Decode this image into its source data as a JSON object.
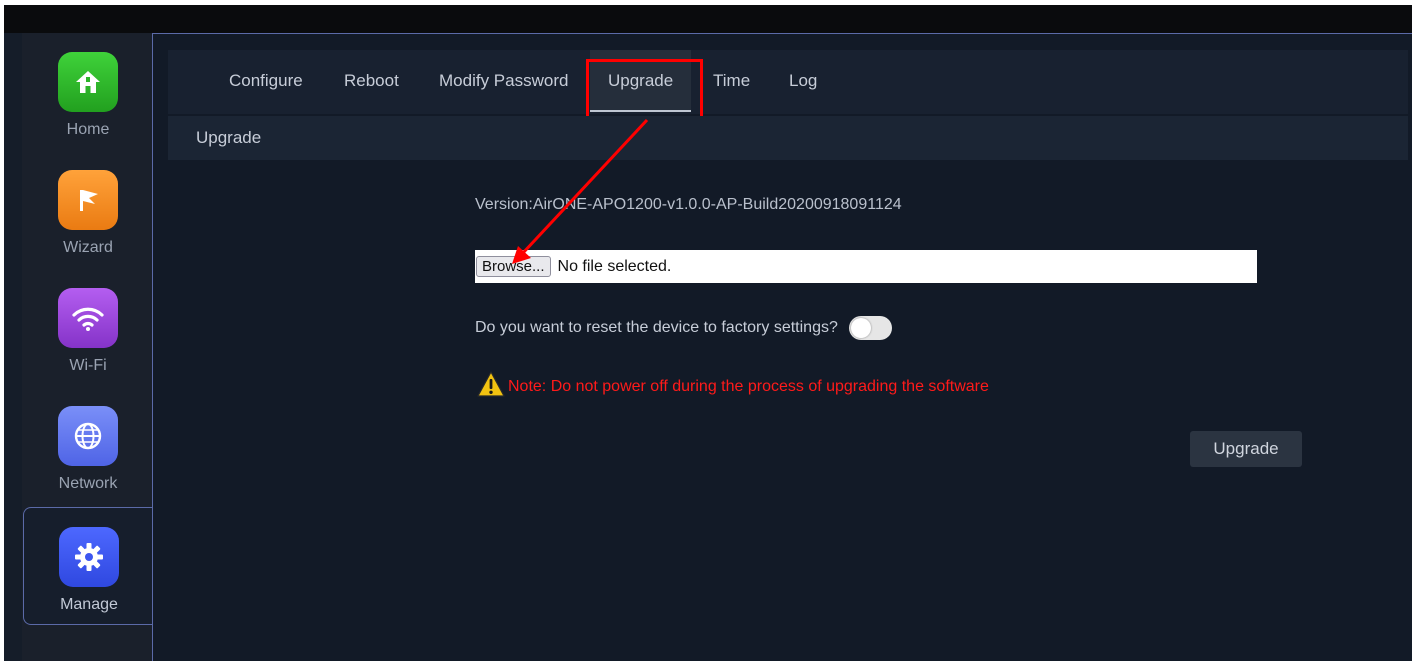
{
  "sidebar": {
    "items": [
      {
        "label": "Home",
        "icon": "home-icon",
        "color": "#2db52a"
      },
      {
        "label": "Wizard",
        "icon": "flag-icon",
        "color": "#f08a1e"
      },
      {
        "label": "Wi-Fi",
        "icon": "wifi-icon",
        "color": "#9b45d6"
      },
      {
        "label": "Network",
        "icon": "globe-icon",
        "color": "#5a74f0"
      },
      {
        "label": "Manage",
        "icon": "gear-icon",
        "color": "#3d56f0",
        "active": true
      }
    ]
  },
  "tabs": [
    {
      "label": "Configure"
    },
    {
      "label": "Reboot"
    },
    {
      "label": "Modify Password"
    },
    {
      "label": "Upgrade",
      "active": true
    },
    {
      "label": "Time"
    },
    {
      "label": "Log"
    }
  ],
  "section": {
    "title": "Upgrade"
  },
  "upgrade": {
    "version_text": "Version:AirONE-APO1200-v1.0.0-AP-Build20200918091124",
    "browse_label": "Browse...",
    "file_status": "No file selected.",
    "reset_question": "Do you want to reset the device to factory settings?",
    "reset_enabled": false,
    "note": "Note: Do not power off during the process of upgrading the software",
    "button_label": "Upgrade"
  },
  "colors": {
    "annotation": "#ff0000",
    "note": "#ff1a1a",
    "background": "#151d29"
  }
}
